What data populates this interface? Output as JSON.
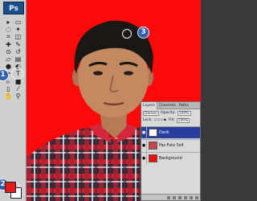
{
  "app": {
    "logo_text": "Ps"
  },
  "toolbox": {
    "tools": [
      {
        "icon": "move-tool-icon"
      },
      {
        "icon": "marquee-tool-icon"
      },
      {
        "icon": "lasso-tool-icon"
      },
      {
        "icon": "magic-wand-tool-icon"
      },
      {
        "icon": "crop-tool-icon"
      },
      {
        "icon": "slice-tool-icon"
      },
      {
        "icon": "healing-brush-tool-icon"
      },
      {
        "icon": "brush-tool-icon"
      },
      {
        "icon": "clone-stamp-tool-icon"
      },
      {
        "icon": "history-brush-tool-icon"
      },
      {
        "icon": "eraser-tool-icon"
      },
      {
        "icon": "gradient-tool-icon"
      },
      {
        "icon": "blur-tool-icon"
      },
      {
        "icon": "dodge-tool-icon"
      },
      {
        "icon": "pen-tool-icon"
      },
      {
        "icon": "type-tool-icon"
      },
      {
        "icon": "path-selection-tool-icon"
      },
      {
        "icon": "shape-tool-icon"
      },
      {
        "icon": "notes-tool-icon"
      },
      {
        "icon": "eyedropper-tool-icon"
      },
      {
        "icon": "hand-tool-icon"
      },
      {
        "icon": "zoom-tool-icon"
      }
    ],
    "foreground_color": "#e51a1a",
    "background_color": "#ffffff"
  },
  "markers": {
    "m1": "1",
    "m2": "2",
    "m3": "3"
  },
  "layers_panel": {
    "tabs": [
      "Layers",
      "Channels",
      "Paths"
    ],
    "blend_mode": "Darken",
    "opacity_label": "Opacity:",
    "opacity_value": "100%",
    "lock_label": "Lock:",
    "fill_label": "Fill:",
    "fill_value": "100%",
    "layers": [
      {
        "name": "Darik",
        "selected": true,
        "thumb": "#ffffff"
      },
      {
        "name": "Pas Foto 3x4",
        "selected": false,
        "thumb": "#c8464a"
      },
      {
        "name": "Background",
        "selected": false,
        "thumb": "#fc0a0a"
      }
    ]
  },
  "colors": {
    "canvas_bg": "#fc0a0a",
    "selection": "#283e9f",
    "marker": "#2d5fae"
  }
}
